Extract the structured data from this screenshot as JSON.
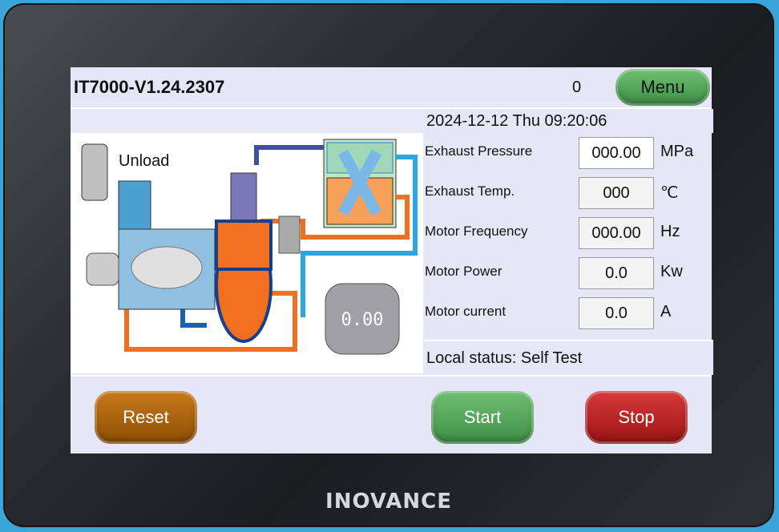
{
  "device": {
    "brand": "INOVANCE"
  },
  "header": {
    "model": "IT7000-V1.24.2307",
    "counter": "0",
    "menu_label": "Menu"
  },
  "datetime": "2024-12-12 Thu 09:20:06",
  "diagram": {
    "mode_label": "Unload",
    "motor_display": "0.00"
  },
  "readings": [
    {
      "label": "Exhaust Pressure",
      "value": "000.00",
      "unit": "MPa"
    },
    {
      "label": "Exhaust Temp.",
      "value": "000",
      "unit": "℃"
    },
    {
      "label": "Motor Frequency",
      "value": "000.00",
      "unit": "Hz"
    },
    {
      "label": "Motor Power",
      "value": "0.0",
      "unit": "Kw"
    },
    {
      "label": "Motor current",
      "value": "0.0",
      "unit": "A"
    }
  ],
  "status": "Local status: Self  Test",
  "buttons": {
    "reset": "Reset",
    "start": "Start",
    "stop": "Stop"
  },
  "colors": {
    "run": "#4e9e55",
    "stop": "#b31f1f",
    "reset": "#a8600d",
    "pipe_hot": "#f07020",
    "pipe_cold": "#2aa7e0"
  }
}
